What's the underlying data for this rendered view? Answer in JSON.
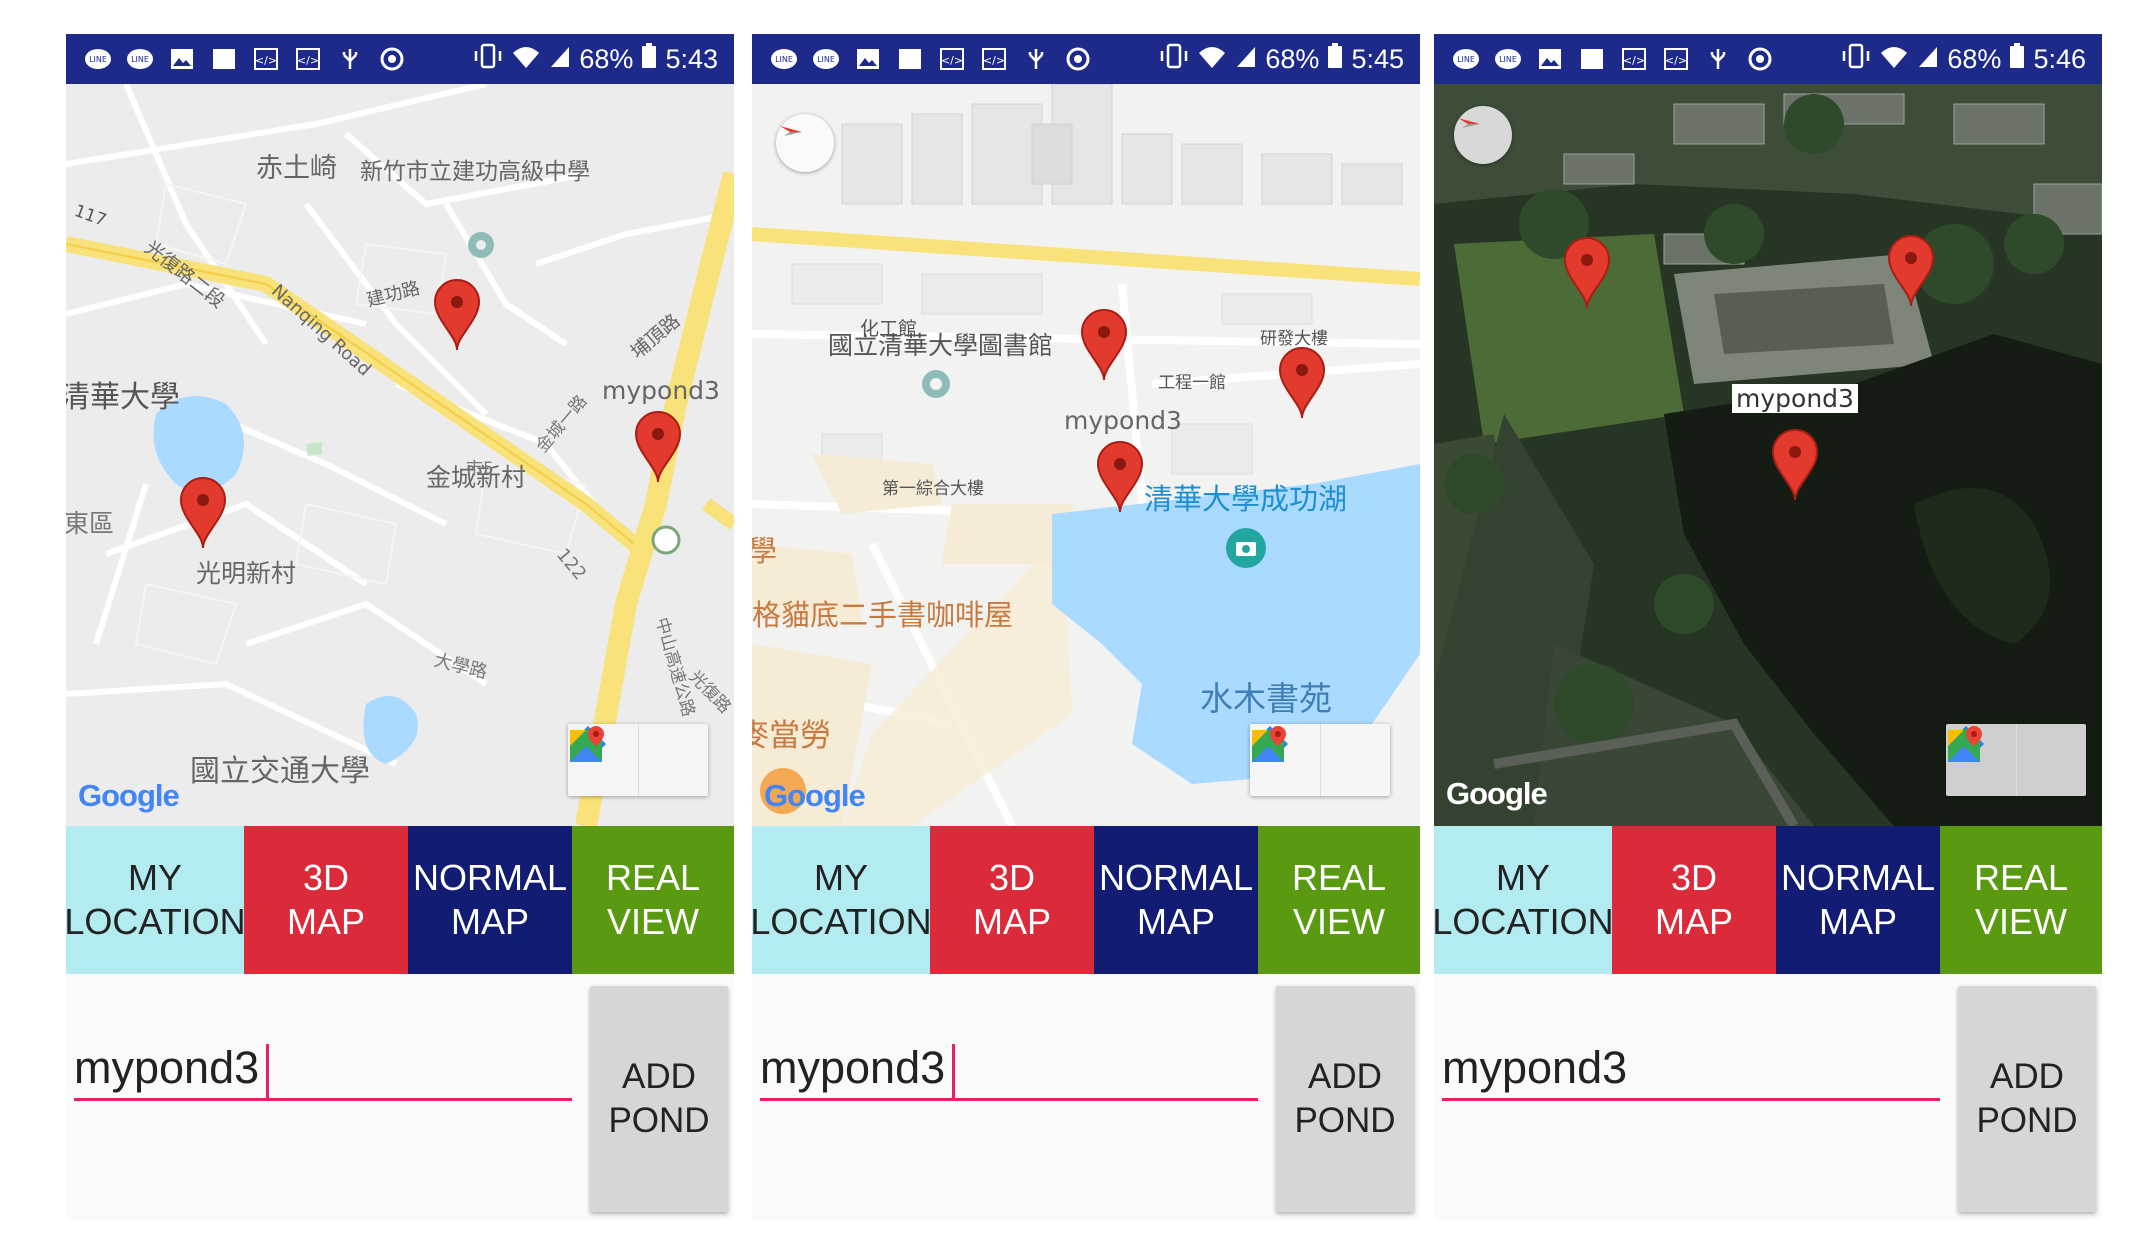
{
  "screens": [
    {
      "status": {
        "battery": "68%",
        "time": "5:43"
      },
      "map_labels": [
        "赤土崎",
        "新竹市立建功高級中學",
        "117",
        "光復路二段",
        "建功路",
        "Nanqing Road",
        "清華大學",
        "埔頂路",
        "mypond3",
        "金城新村",
        "東區",
        "光明新村",
        "122",
        "大學路",
        "中山高速公路",
        "光復路",
        "國立交通大學",
        "金城一路",
        "市5"
      ],
      "google_logo": "Google",
      "buttons": {
        "my_location": "MY\nLOCATION",
        "map_3d": "3D\nMAP",
        "normal_map": "NORMAL\nMAP",
        "real_view": "REAL\nVIEW"
      },
      "input_value": "mypond3",
      "add_button": "ADD\nPOND"
    },
    {
      "status": {
        "battery": "68%",
        "time": "5:45"
      },
      "map_labels": [
        "化工館",
        "國立清華大學圖書館",
        "研發大樓",
        "工程一館",
        "mypond3",
        "第一綜合大樓",
        "清華大學成功湖",
        "學",
        "格貓底二手書咖啡屋",
        "水木書苑",
        "麥當勞"
      ],
      "google_logo": "Google",
      "buttons": {
        "my_location": "MY\nLOCATION",
        "map_3d": "3D\nMAP",
        "normal_map": "NORMAL\nMAP",
        "real_view": "REAL\nVIEW"
      },
      "input_value": "mypond3",
      "add_button": "ADD\nPOND"
    },
    {
      "status": {
        "battery": "68%",
        "time": "5:46"
      },
      "map_labels": [
        "mypond3"
      ],
      "google_logo": "Google",
      "buttons": {
        "my_location": "MY\nLOCATION",
        "map_3d": "3D\nMAP",
        "normal_map": "NORMAL\nMAP",
        "real_view": "REAL\nVIEW"
      },
      "input_value": "mypond3",
      "add_button": "ADD\nPOND"
    }
  ],
  "colors": {
    "status_bar": "#1e2a8a",
    "my_location": "#b2ebf0",
    "map_3d": "#db2a3a",
    "normal_map": "#111c72",
    "real_view": "#5a9a10",
    "marker": "#e23b2e",
    "input_underline": "#e91e63"
  },
  "icons": {
    "status_left": [
      "line-icon",
      "line-icon",
      "image-icon",
      "square-icon",
      "code-icon",
      "code-icon",
      "usb-icon",
      "chrome-icon"
    ],
    "status_right": [
      "vibrate-icon",
      "wifi-icon",
      "signal-icon",
      "battery-icon"
    ],
    "map_tools": [
      "directions-icon",
      "google-maps-icon"
    ]
  }
}
